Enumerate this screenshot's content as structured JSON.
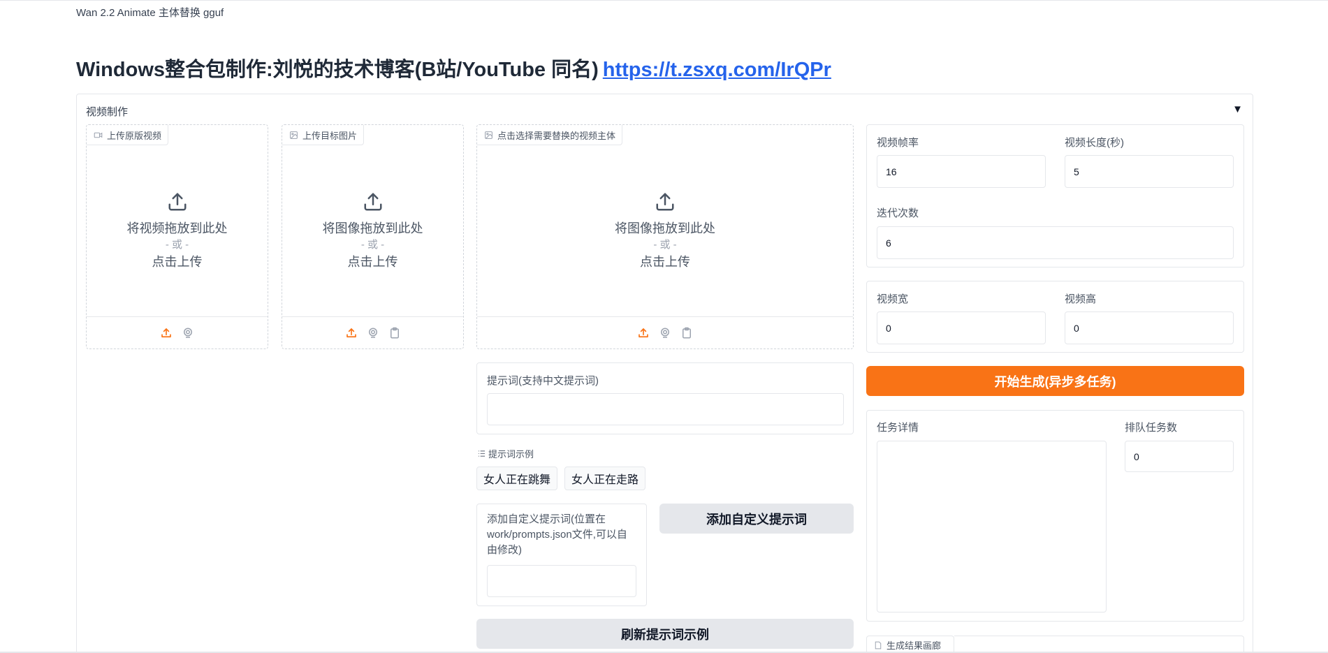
{
  "app": {
    "title": "Wan 2.2 Animate 主体替换 gguf"
  },
  "header": {
    "heading": "Windows整合包制作:刘悦的技术博客(B站/YouTube 同名)",
    "link_text": "https://t.zsxq.com/IrQPr"
  },
  "accordion": {
    "label": "视频制作",
    "caret": "▼"
  },
  "uploads": [
    {
      "tag": "上传原版视频",
      "icon": "video-icon",
      "drop_text": "将视频拖放到此处",
      "or_text": "- 或 -",
      "click_text": "点击上传",
      "sources": [
        "upload-icon",
        "webcam-icon"
      ]
    },
    {
      "tag": "上传目标图片",
      "icon": "image-icon",
      "drop_text": "将图像拖放到此处",
      "or_text": "- 或 -",
      "click_text": "点击上传",
      "sources": [
        "upload-icon",
        "webcam-icon",
        "clipboard-icon"
      ]
    },
    {
      "tag": "点击选择需要替换的视频主体",
      "icon": "image-icon",
      "drop_text": "将图像拖放到此处",
      "or_text": "- 或 -",
      "click_text": "点击上传",
      "sources": [
        "upload-icon",
        "webcam-icon",
        "clipboard-icon"
      ]
    }
  ],
  "settings": {
    "fps_label": "视频帧率",
    "fps_value": "16",
    "length_label": "视频长度(秒)",
    "length_value": "5",
    "steps_label": "迭代次数",
    "steps_value": "6",
    "width_label": "视频宽",
    "width_value": "0",
    "height_label": "视频高",
    "height_value": "0"
  },
  "prompt": {
    "label": "提示词(支持中文提示词)",
    "value": ""
  },
  "examples": {
    "label": "提示词示例",
    "items": [
      "女人正在跳舞",
      "女人正在走路"
    ]
  },
  "custom_prompt": {
    "label_line1": "添加自定义提示词(位置在",
    "label_line2": "work/prompts.json文件,可以自",
    "label_line3": "由修改)",
    "value": ""
  },
  "buttons": {
    "generate": "开始生成(异步多任务)",
    "add_custom": "添加自定义提示词",
    "refresh_examples": "刷新提示词示例"
  },
  "task": {
    "detail_label": "任务详情",
    "detail_value": "",
    "queue_label": "排队任务数",
    "queue_value": "0"
  },
  "gallery": {
    "label": "生成结果画廊"
  },
  "colors": {
    "accent": "#f97316",
    "link": "#2563eb",
    "border": "#e5e7eb"
  }
}
